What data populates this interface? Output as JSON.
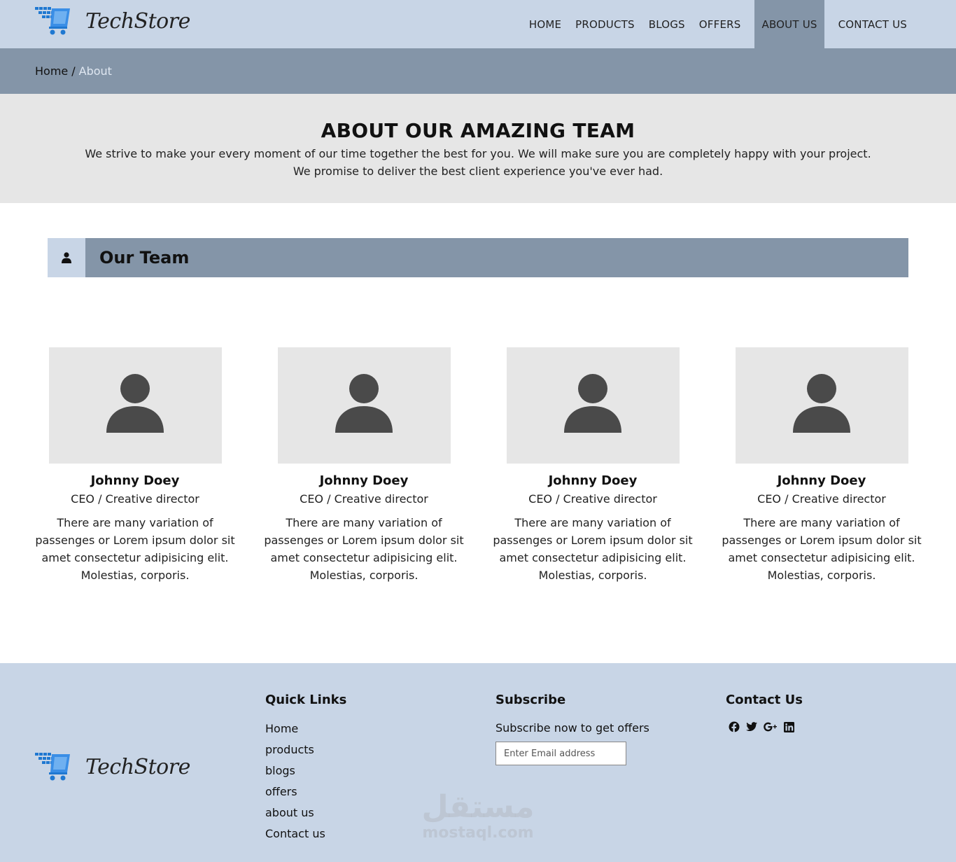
{
  "brand": {
    "name": "TechStore"
  },
  "nav": {
    "items": [
      {
        "label": "HOME",
        "active": false
      },
      {
        "label": "PRODUCTS",
        "active": false
      },
      {
        "label": "BLOGS",
        "active": false
      },
      {
        "label": "OFFERS",
        "active": false
      },
      {
        "label": "ABOUT US",
        "active": true
      },
      {
        "label": "CONTACT US",
        "active": false
      }
    ]
  },
  "breadcrumb": {
    "home": "Home",
    "separator": "/",
    "current": "About"
  },
  "hero": {
    "title": "ABOUT OUR AMAZING TEAM",
    "line1": "We strive to make your every moment of our time together the best for you. We will make sure you are completely happy with your project.",
    "line2": "We promise to deliver the best client experience you've ever had."
  },
  "team_section": {
    "title": "Our Team",
    "icon": "user-icon"
  },
  "team": [
    {
      "name": "Johnny Doey",
      "role": "CEO / Creative director",
      "desc": "There are many variation of passenges or Lorem ipsum dolor sit amet consectetur adipisicing elit. Molestias, corporis."
    },
    {
      "name": "Johnny Doey",
      "role": "CEO / Creative director",
      "desc": "There are many variation of passenges or Lorem ipsum dolor sit amet consectetur adipisicing elit. Molestias, corporis."
    },
    {
      "name": "Johnny Doey",
      "role": "CEO / Creative director",
      "desc": "There are many variation of passenges or Lorem ipsum dolor sit amet consectetur adipisicing elit. Molestias, corporis."
    },
    {
      "name": "Johnny Doey",
      "role": "CEO / Creative director",
      "desc": "There are many variation of passenges or Lorem ipsum dolor sit amet consectetur adipisicing elit. Molestias, corporis."
    }
  ],
  "footer": {
    "quick_links": {
      "title": "Quick Links",
      "links": [
        "Home",
        "products",
        "blogs",
        "offers",
        "about us",
        "Contact us"
      ]
    },
    "subscribe": {
      "title": "Subscribe",
      "text": "Subscribe now to get offers",
      "placeholder": "Enter Email address"
    },
    "contact": {
      "title": "Contact Us",
      "social_icons": [
        "facebook-icon",
        "twitter-icon",
        "google-plus-icon",
        "linkedin-icon"
      ]
    }
  },
  "watermark": {
    "arabic": "مستقل",
    "latin": "mostaql.com"
  },
  "colors": {
    "header_bg": "#c8d5e6",
    "accent_bar": "#8495a8",
    "hero_bg": "#e6e6e6",
    "logo_blue": "#1f78d1"
  }
}
